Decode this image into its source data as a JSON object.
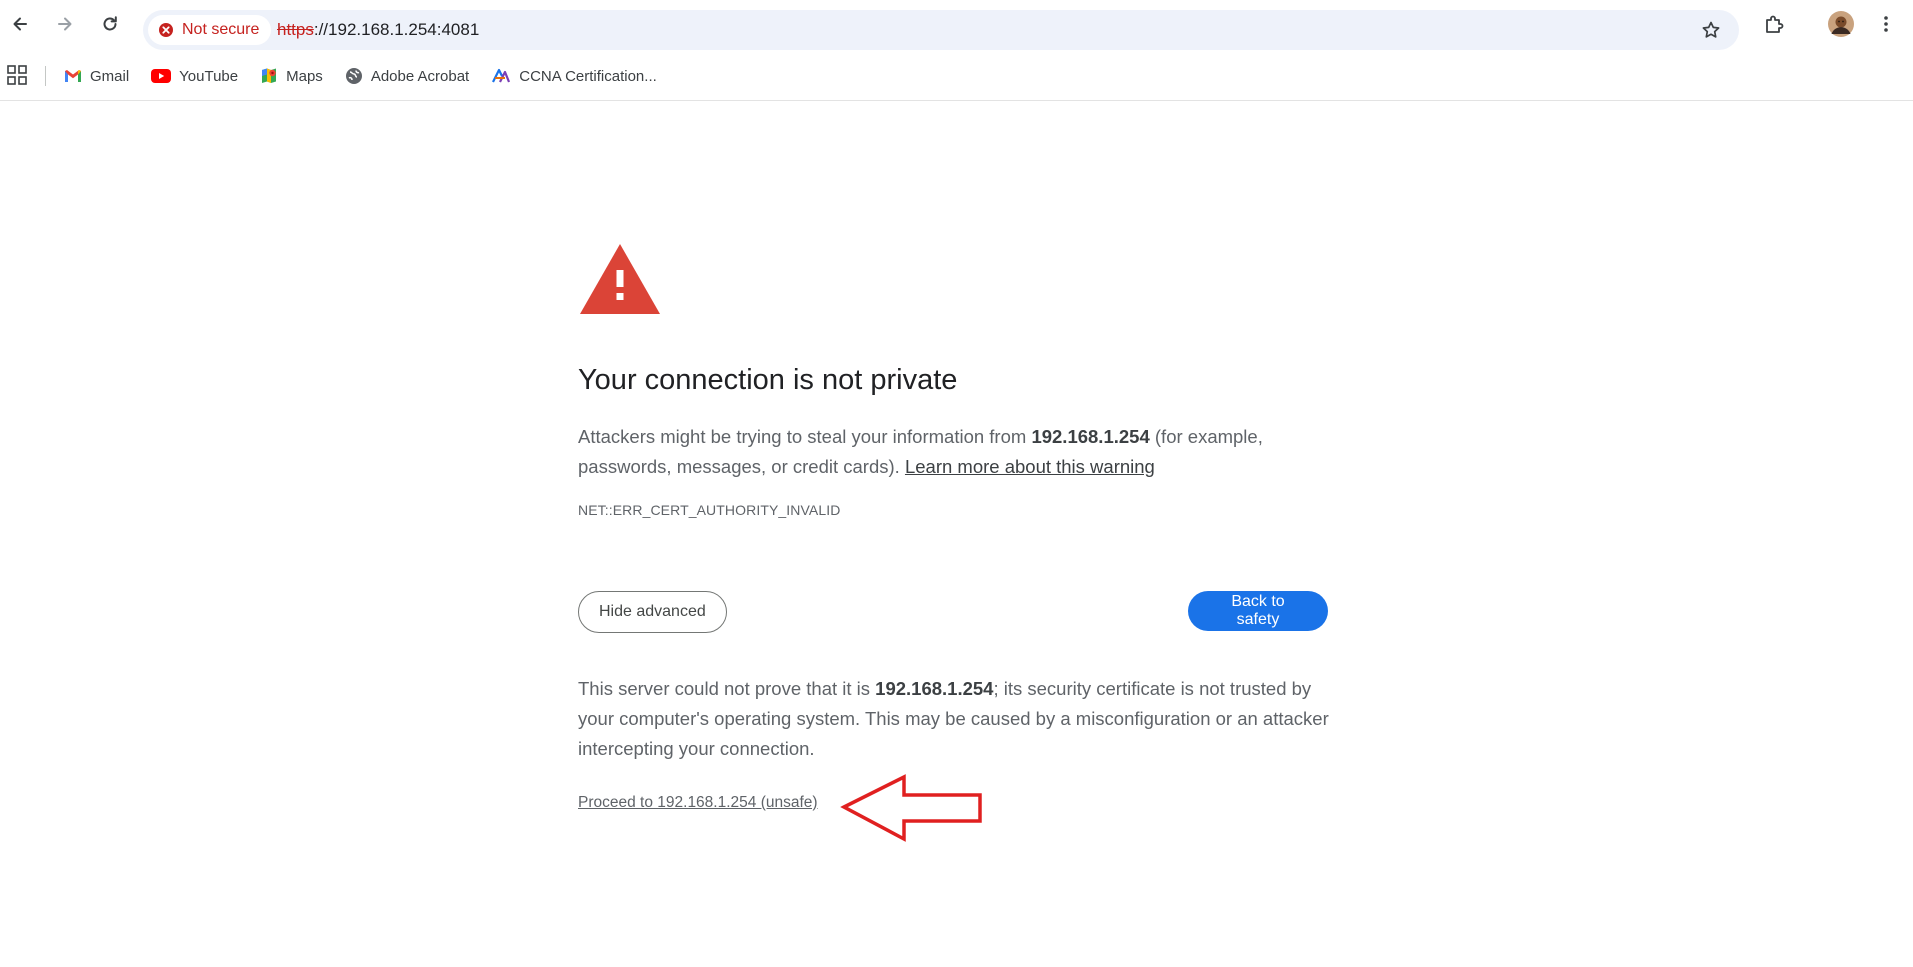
{
  "browser": {
    "security_chip": "Not secure",
    "url_scheme": "https",
    "url_rest": "://192.168.1.254:4081"
  },
  "bookmarks": [
    {
      "label": "Gmail",
      "icon": "gmail-icon"
    },
    {
      "label": "YouTube",
      "icon": "youtube-icon"
    },
    {
      "label": "Maps",
      "icon": "maps-icon"
    },
    {
      "label": "Adobe Acrobat",
      "icon": "globe-icon"
    },
    {
      "label": "CCNA Certification...",
      "icon": "ccna-icon"
    }
  ],
  "interstitial": {
    "heading": "Your connection is not private",
    "main_pre": "Attackers might be trying to steal your information from ",
    "main_host": "192.168.1.254",
    "main_post": " (for example, passwords, messages, or credit cards). ",
    "learn_more": "Learn more about this warning",
    "error_code": "NET::ERR_CERT_AUTHORITY_INVALID",
    "hide_advanced": "Hide advanced",
    "back_to_safety": "Back to safety",
    "details_pre": "This server could not prove that it is ",
    "details_host": "192.168.1.254",
    "details_post": "; its security certificate is not trusted by your computer's operating system. This may be caused by a misconfiguration or an attacker intercepting your connection.",
    "proceed_link": "Proceed to 192.168.1.254 (unsafe)"
  },
  "colors": {
    "accent": "#1a73e8",
    "danger": "#c5221f",
    "warning_icon": "#db4437",
    "annotation_arrow": "#e02020"
  }
}
